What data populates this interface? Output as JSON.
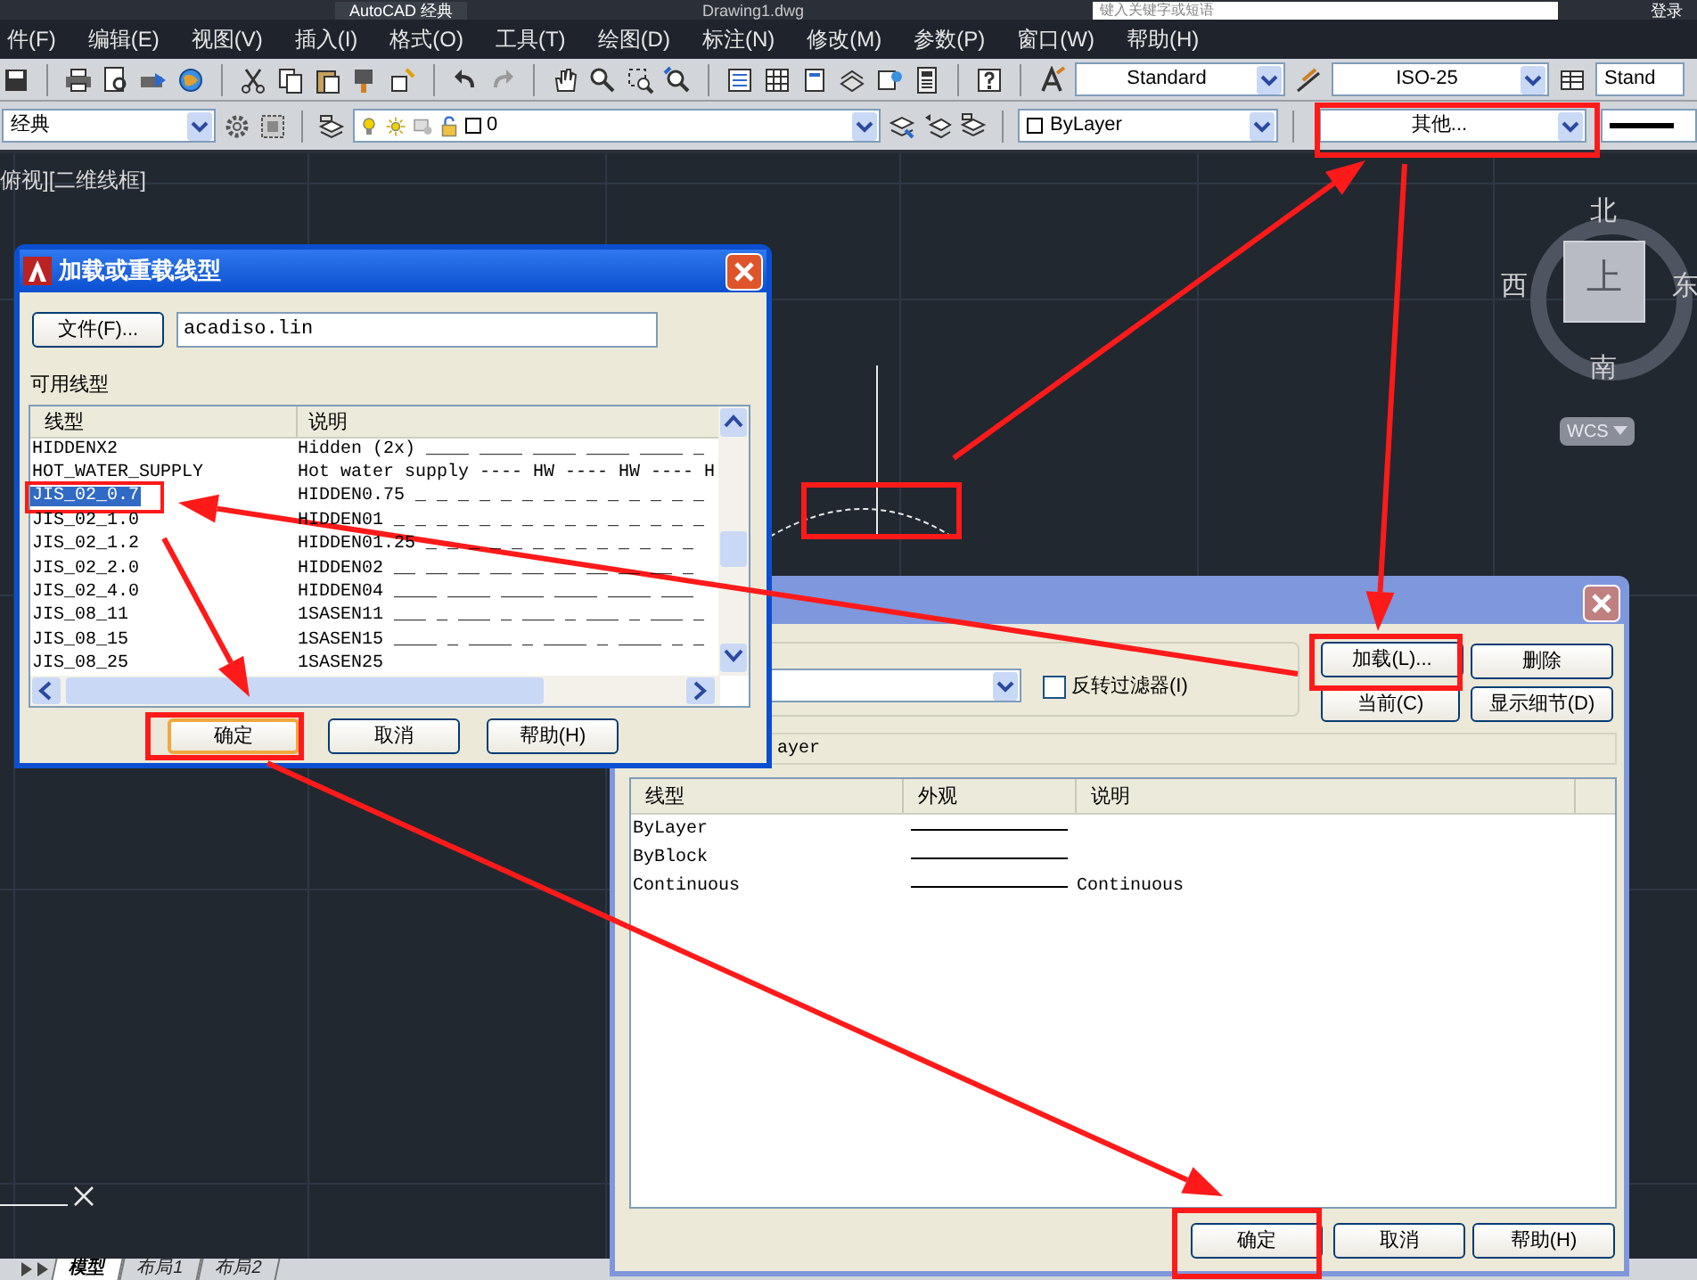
{
  "title_bar": {
    "workspace": "AutoCAD 经典",
    "document": "Drawing1.dwg",
    "search_placeholder": "键入关键字或短语",
    "sign_in": "登录"
  },
  "menu": [
    "件(F)",
    "编辑(E)",
    "视图(V)",
    "插入(I)",
    "格式(O)",
    "工具(T)",
    "绘图(D)",
    "标注(N)",
    "修改(M)",
    "参数(P)",
    "窗口(W)",
    "帮助(H)"
  ],
  "styles_toolbar": {
    "text_style": "Standard",
    "dimension_style": "ISO-25",
    "table_style": "Stand"
  },
  "properties_toolbar": {
    "workspace": "经典",
    "layer": "0",
    "color_setting": "ByLayer",
    "linetype": "其他..."
  },
  "viewport_label": "俯视][二维线框]",
  "viewcube": {
    "north": "北",
    "south": "南",
    "west": "西",
    "east": "东",
    "face": "上",
    "ucs": "WCS"
  },
  "load_dialog": {
    "title": "加载或重载线型",
    "file_button": "文件(F)...",
    "file_name": "acadiso.lin",
    "list_label": "可用线型",
    "columns": [
      "线型",
      "说明"
    ],
    "rows": [
      {
        "name": "HIDDENX2",
        "description": "Hidden (2x) ____ ____ ____ ____ ____ _",
        "selected": false
      },
      {
        "name": "HOT_WATER_SUPPLY",
        "description": "Hot water supply ---- HW ---- HW ---- H",
        "selected": false
      },
      {
        "name": "JIS_02_0.7",
        "description": "HIDDEN0.75 _ _ _ _ _ _ _ _ _ _ _ _ _ _",
        "selected": true
      },
      {
        "name": "JIS_02_1.0",
        "description": "HIDDEN01 _ _ _ _ _ _ _ _ _ _ _ _ _ _ _",
        "selected": false
      },
      {
        "name": "JIS_02_1.2",
        "description": "HIDDEN01.25 _ _ _ _ _ _ _ _ _ _ _ _ _",
        "selected": false
      },
      {
        "name": "JIS_02_2.0",
        "description": "HIDDEN02 __ __ __ __ __ __ __ __ __ _",
        "selected": false
      },
      {
        "name": "JIS_02_4.0",
        "description": "HIDDEN04 ____ ____ ____ ____ ____ ___",
        "selected": false
      },
      {
        "name": "JIS_08_11",
        "description": "1SASEN11 ___ _ ___ _ ___ _ ___ _ ___ _",
        "selected": false
      },
      {
        "name": "JIS_08_15",
        "description": "1SASEN15 ____ _ ____ _ ____ _ ____ _ _",
        "selected": false
      },
      {
        "name": "JIS_08_25",
        "description": "1SASEN25",
        "selected": false
      }
    ],
    "buttons": [
      {
        "label": "确定",
        "default": true
      },
      {
        "label": "取消",
        "default": false
      },
      {
        "label": "帮助(H)",
        "default": false
      }
    ]
  },
  "manager_dialog": {
    "invert_filter": {
      "label": "反转过滤器(I)",
      "checked": false
    },
    "buttons": [
      "加载(L)...",
      "删除",
      "当前(C)",
      "显示细节(D)"
    ],
    "current_linetype": "ayer",
    "columns": [
      "线型",
      "外观",
      "说明"
    ],
    "rows": [
      {
        "name": "ByLayer"
      },
      {
        "name": "ByBlock"
      },
      {
        "name": "Continuous",
        "description": "Continuous"
      }
    ],
    "footer_buttons": [
      "确定",
      "取消",
      "帮助(H)"
    ]
  },
  "layout_tabs": [
    {
      "label": "模型",
      "selected": true
    },
    {
      "label": "布局1",
      "selected": false
    },
    {
      "label": "布局2",
      "selected": false
    }
  ]
}
